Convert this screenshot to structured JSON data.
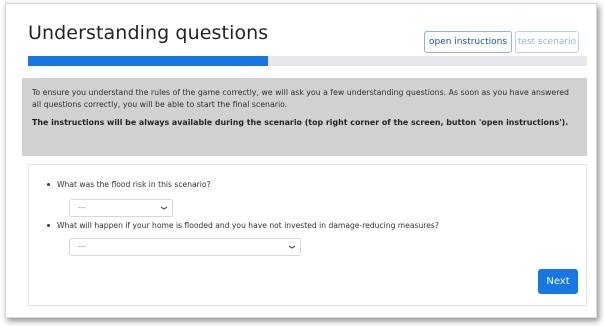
{
  "header": {
    "title": "Understanding questions",
    "open_instructions_label": "open instructions",
    "test_scenario_label": "test scenario"
  },
  "progress": {
    "fraction": 0.43
  },
  "info": {
    "text": "To ensure you understand the rules of the game correctly, we will ask you a few understanding questions. As soon as you have answered all questions correctly, you will be able to start the final scenario.",
    "note": "The instructions will be always available during the scenario (top right corner of the screen, button 'open instructions')."
  },
  "questions": [
    {
      "text": "What was the flood risk in this scenario?",
      "selected": "---"
    },
    {
      "text": "What will happen if your home is flooded and you have not invested in damage-reducing measures?",
      "selected": "---"
    }
  ],
  "next_label": "Next",
  "colors": {
    "primary": "#1677e6",
    "info_bg": "#d0d1d3",
    "progress_track": "#e6e8eb"
  },
  "icons": {
    "select_arrow": "chevron-down-icon"
  }
}
